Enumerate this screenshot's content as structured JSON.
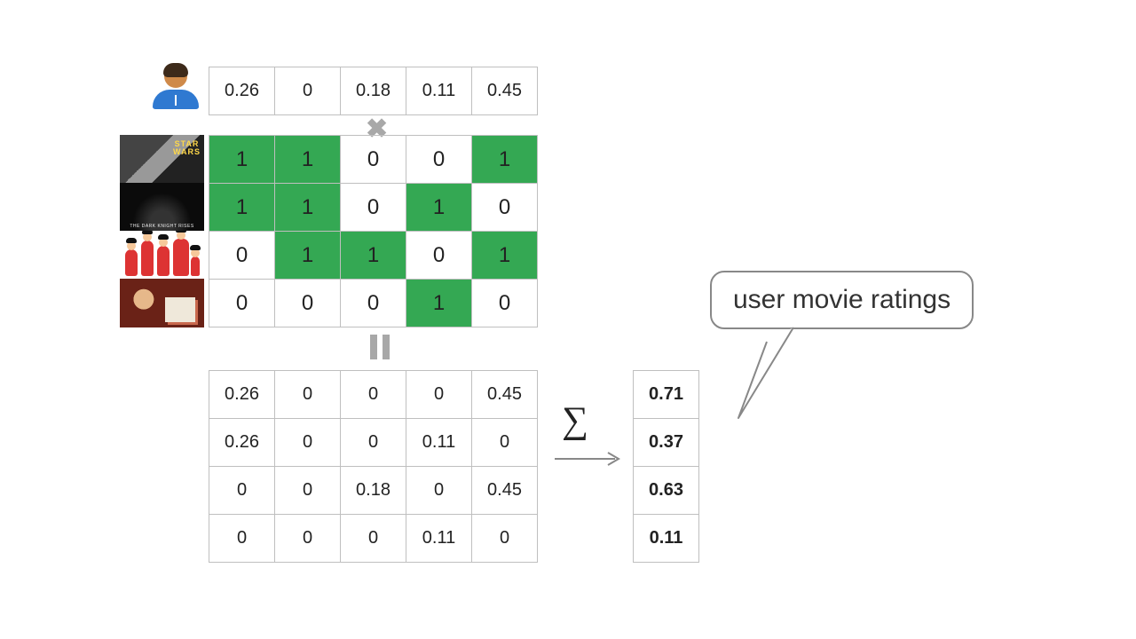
{
  "user_vector": [
    "0.26",
    "0",
    "0.18",
    "0.11",
    "0.45"
  ],
  "movies": [
    "star-wars",
    "dark-knight",
    "incredibles",
    "memento"
  ],
  "binary_matrix": [
    [
      1,
      1,
      0,
      0,
      1
    ],
    [
      1,
      1,
      0,
      1,
      0
    ],
    [
      0,
      1,
      1,
      0,
      1
    ],
    [
      0,
      0,
      0,
      1,
      0
    ]
  ],
  "product_matrix": [
    [
      "0.26",
      "0",
      "0",
      "0",
      "0.45"
    ],
    [
      "0.26",
      "0",
      "0",
      "0.11",
      "0"
    ],
    [
      "0",
      "0",
      "0.18",
      "0",
      "0.45"
    ],
    [
      "0",
      "0",
      "0",
      "0.11",
      "0"
    ]
  ],
  "sums": [
    "0.71",
    "0.37",
    "0.63",
    "0.11"
  ],
  "symbols": {
    "multiply": "✖",
    "sigma": "∑"
  },
  "callout_label": "user movie ratings",
  "chart_data": {
    "type": "table",
    "title": "Content-based user-movie dot product",
    "user_feature_vector": [
      0.26,
      0,
      0.18,
      0.11,
      0.45
    ],
    "movie_feature_matrix": [
      [
        1,
        1,
        0,
        0,
        1
      ],
      [
        1,
        1,
        0,
        1,
        0
      ],
      [
        0,
        1,
        1,
        0,
        1
      ],
      [
        0,
        0,
        0,
        1,
        0
      ]
    ],
    "elementwise_product": [
      [
        0.26,
        0,
        0,
        0,
        0.45
      ],
      [
        0.26,
        0,
        0,
        0.11,
        0
      ],
      [
        0,
        0,
        0.18,
        0,
        0.45
      ],
      [
        0,
        0,
        0,
        0.11,
        0
      ]
    ],
    "row_sums": [
      0.71,
      0.37,
      0.63,
      0.11
    ],
    "row_sum_label": "user movie ratings"
  }
}
